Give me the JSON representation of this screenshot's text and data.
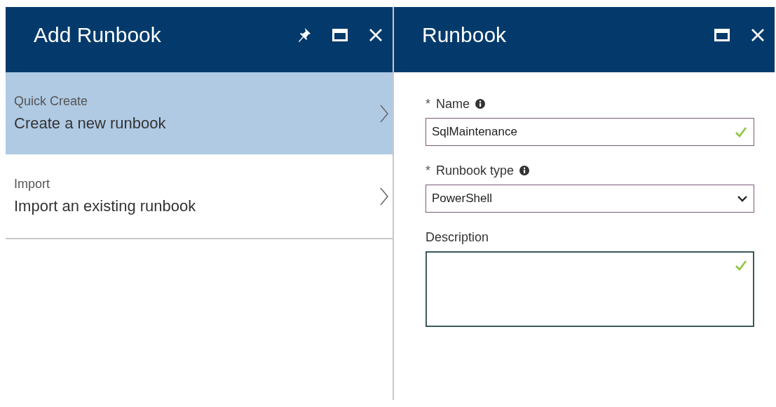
{
  "blades": [
    {
      "title": "Add Runbook",
      "buttons": [
        {
          "kind": "pin"
        },
        {
          "kind": "maximize"
        },
        {
          "kind": "close"
        }
      ],
      "options": [
        {
          "caption": "Quick Create",
          "text": "Create a new runbook",
          "selected": true
        },
        {
          "caption": "Import",
          "text": "Import an existing runbook",
          "selected": false
        }
      ]
    },
    {
      "title": "Runbook",
      "buttons": [
        {
          "kind": "maximize"
        },
        {
          "kind": "close"
        }
      ],
      "fields": [
        {
          "kind": "text",
          "required_mark": "*",
          "label": "Name",
          "info": true,
          "value": "SqlMaintenance",
          "valid": true,
          "focused": false
        },
        {
          "kind": "select",
          "required_mark": "*",
          "label": "Runbook type",
          "info": true,
          "value": "PowerShell",
          "valid": false,
          "focused": false
        },
        {
          "kind": "textarea",
          "label": "Description",
          "info": false,
          "valid": true,
          "focused": true
        }
      ]
    }
  ]
}
